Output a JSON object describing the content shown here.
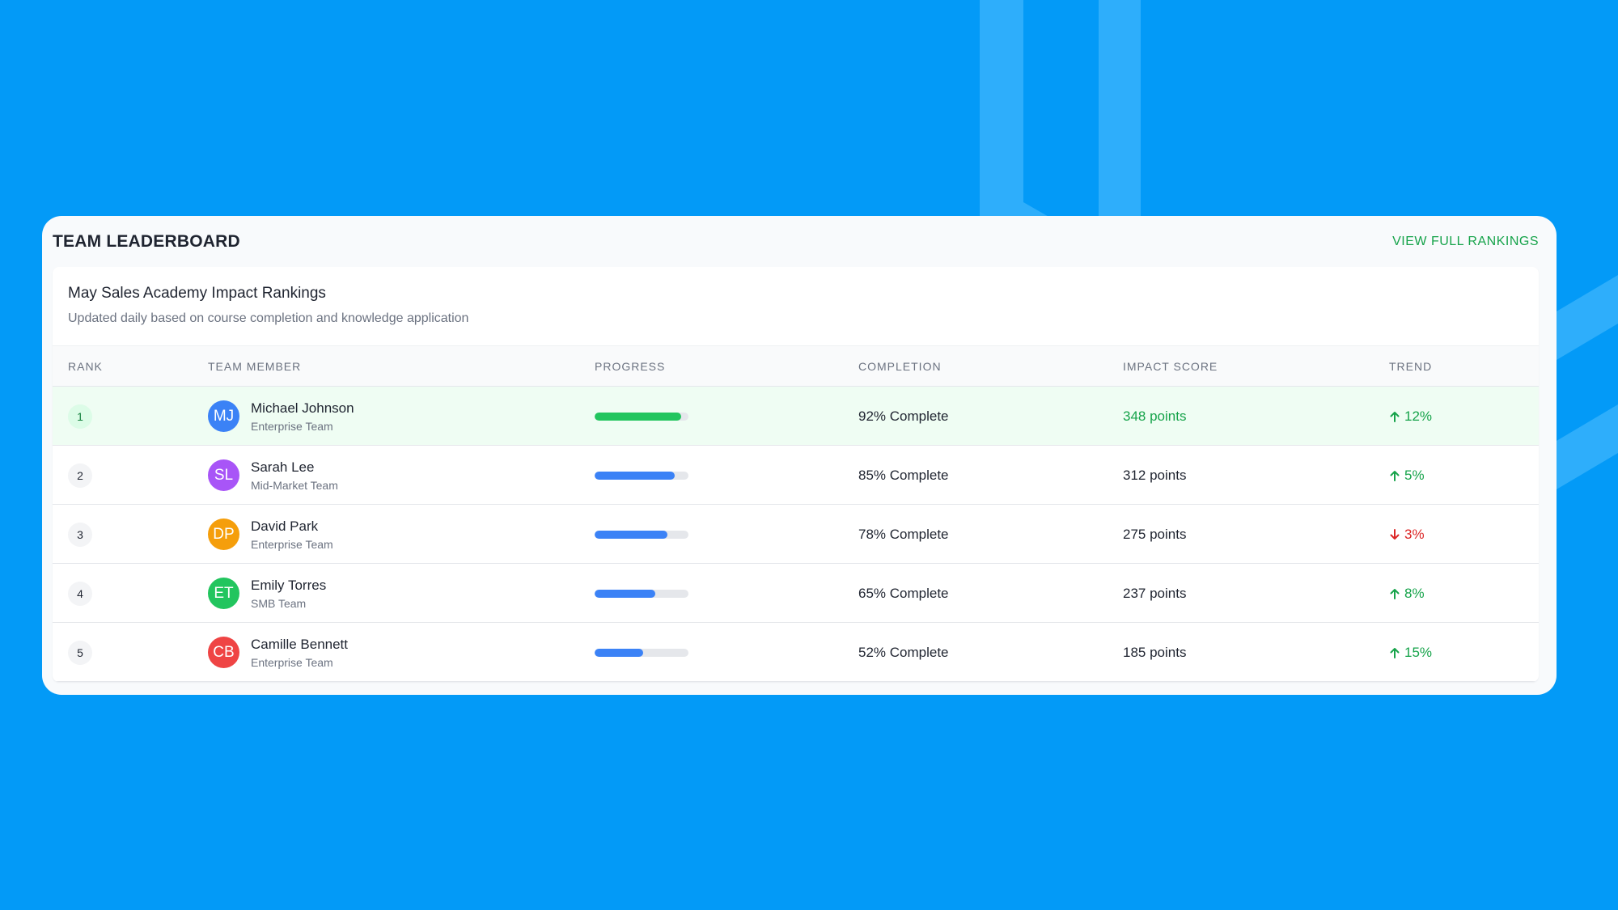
{
  "colors": {
    "background": "#039af7",
    "accent_green": "#16a34a",
    "progress_blue": "#3b82f6",
    "trend_up": "#16a34a",
    "trend_down": "#dc2626"
  },
  "header": {
    "title": "TEAM LEADERBOARD",
    "view_all": "VIEW FULL RANKINGS"
  },
  "panel": {
    "title": "May Sales Academy Impact Rankings",
    "subtitle": "Updated daily based on course completion and knowledge application"
  },
  "columns": [
    "RANK",
    "TEAM MEMBER",
    "PROGRESS",
    "COMPLETION",
    "IMPACT SCORE",
    "TREND"
  ],
  "rows": [
    {
      "rank": "1",
      "initials": "MJ",
      "avatar_color": "#3b82f6",
      "name": "Michael Johnson",
      "team": "Enterprise Team",
      "progress": 0.92,
      "progress_color": "#22c55e",
      "completion": "92% Complete",
      "score": "348 points",
      "trend_direction": "up",
      "trend": "12%"
    },
    {
      "rank": "2",
      "initials": "SL",
      "avatar_color": "#a855f7",
      "name": "Sarah Lee",
      "team": "Mid-Market Team",
      "progress": 0.85,
      "progress_color": "#3b82f6",
      "completion": "85% Complete",
      "score": "312 points",
      "trend_direction": "up",
      "trend": "5%"
    },
    {
      "rank": "3",
      "initials": "DP",
      "avatar_color": "#f59e0b",
      "name": "David Park",
      "team": "Enterprise Team",
      "progress": 0.78,
      "progress_color": "#3b82f6",
      "completion": "78% Complete",
      "score": "275 points",
      "trend_direction": "down",
      "trend": "3%"
    },
    {
      "rank": "4",
      "initials": "ET",
      "avatar_color": "#22c55e",
      "name": "Emily Torres",
      "team": "SMB Team",
      "progress": 0.65,
      "progress_color": "#3b82f6",
      "completion": "65% Complete",
      "score": "237 points",
      "trend_direction": "up",
      "trend": "8%"
    },
    {
      "rank": "5",
      "initials": "CB",
      "avatar_color": "#ef4444",
      "name": "Camille Bennett",
      "team": "Enterprise Team",
      "progress": 0.52,
      "progress_color": "#3b82f6",
      "completion": "52% Complete",
      "score": "185 points",
      "trend_direction": "up",
      "trend": "15%"
    }
  ]
}
